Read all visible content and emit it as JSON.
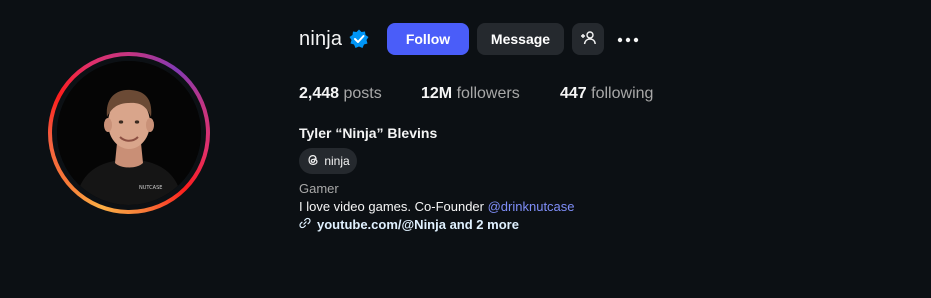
{
  "profile": {
    "username": "ninja",
    "full_name": "Tyler “Ninja” Blevins",
    "threads_handle": "ninja",
    "category": "Gamer",
    "bio_text": "I love video games. Co-Founder ",
    "bio_mention": "@drinknutcase",
    "link_text": "youtube.com/@Ninja and 2 more",
    "shirt_text": "NUTCASE"
  },
  "actions": {
    "follow_label": "Follow",
    "message_label": "Message"
  },
  "stats": {
    "posts_count": "2,448",
    "posts_label": "posts",
    "followers_count": "12M",
    "followers_label": "followers",
    "following_count": "447",
    "following_label": "following"
  },
  "colors": {
    "background": "#0c1014",
    "follow_button": "#4a5df9",
    "secondary_button": "#25292e",
    "verified_badge": "#0095f6",
    "mention_link": "#7f8ef8"
  },
  "icons": {
    "verified": "verified-badge-icon",
    "add_user": "add-user-icon",
    "more": "more-options-icon",
    "threads": "threads-icon",
    "link": "link-icon"
  }
}
